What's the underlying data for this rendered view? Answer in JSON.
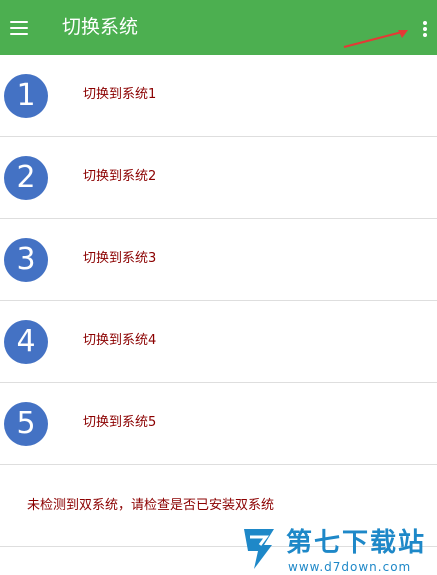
{
  "header": {
    "title": "切换系统",
    "menu_icon": "hamburger-menu-icon",
    "overflow_icon": "more-vert-icon",
    "color": "#4caf50"
  },
  "items": [
    {
      "number": "1",
      "label": "切换到系统1"
    },
    {
      "number": "2",
      "label": "切换到系统2"
    },
    {
      "number": "3",
      "label": "切换到系统3"
    },
    {
      "number": "4",
      "label": "切换到系统4"
    },
    {
      "number": "5",
      "label": "切换到系统5"
    }
  ],
  "status": {
    "text": "未检测到双系统，请检查是否已安装双系统"
  },
  "watermark": {
    "name": "第七下载站",
    "url": "www.d7down.com"
  },
  "colors": {
    "circle": "#4472c4",
    "label_text": "#8b0000",
    "annotation_arrow": "#e53935"
  }
}
